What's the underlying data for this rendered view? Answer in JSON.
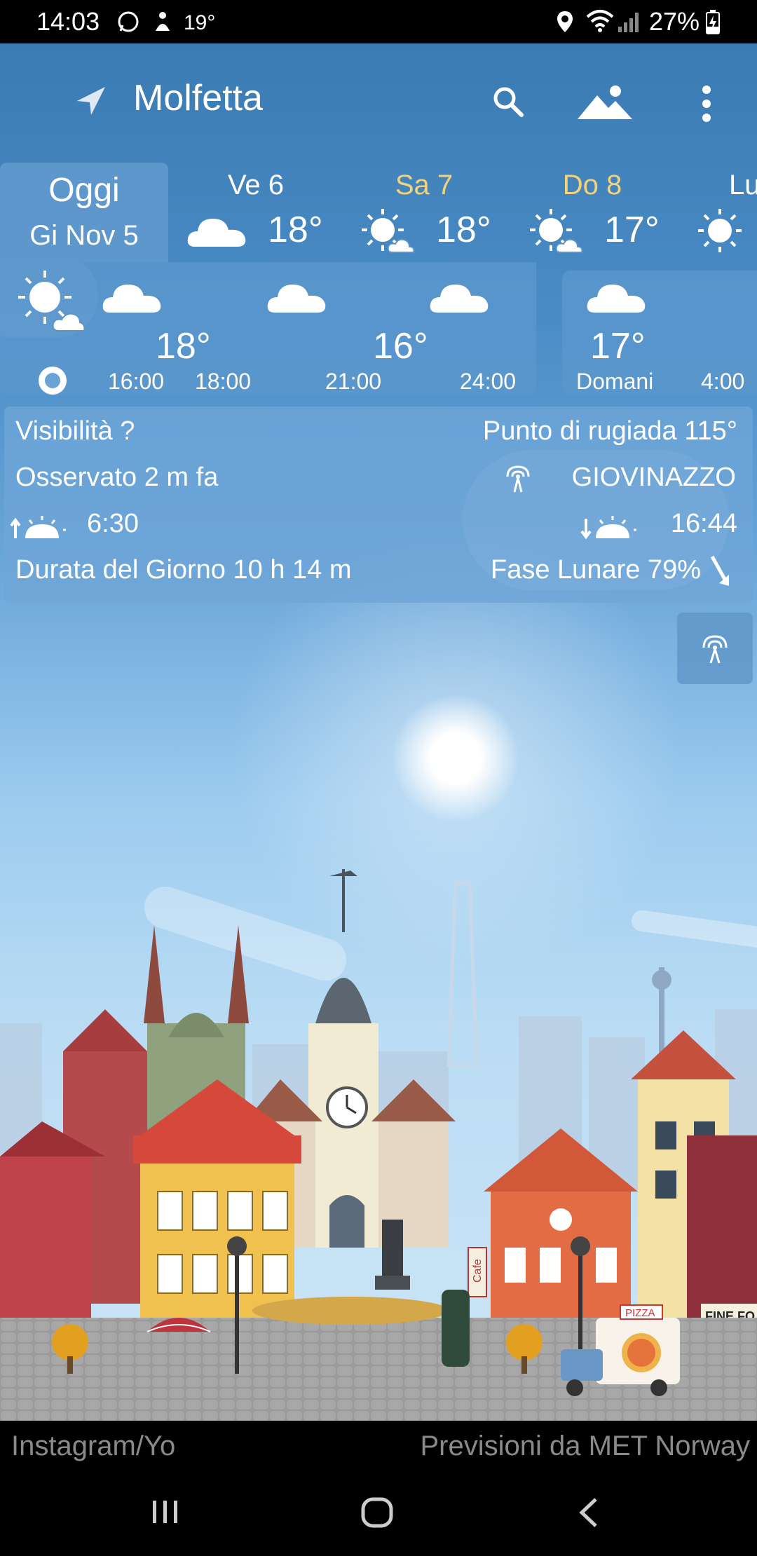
{
  "status_bar": {
    "time": "14:03",
    "notif_temp": "19°",
    "battery": "27%"
  },
  "header": {
    "city": "Molfetta"
  },
  "days": [
    {
      "name": "Oggi",
      "date": "Gi Nov 5"
    },
    {
      "name": "Ve 6",
      "temp": "18°",
      "icon": "cloud-icon"
    },
    {
      "name": "Sa 7",
      "temp": "18°",
      "icon": "sun-cloud-icon"
    },
    {
      "name": "Do 8",
      "temp": "17°",
      "icon": "sun-cloud-icon"
    },
    {
      "name": "Lu",
      "icon": "sun-icon"
    }
  ],
  "hourly": {
    "temps": [
      "18°",
      "16°",
      "17°"
    ],
    "times": [
      "16:00",
      "18:00",
      "21:00",
      "24:00",
      "Domani",
      "4:00"
    ]
  },
  "details": {
    "visibility": "Visibilità ?",
    "dew_point": "Punto di rugiada 115°",
    "observed": "Osservato 2 m fa",
    "station": "GIOVINAZZO",
    "sunrise": "6:30",
    "sunset": "16:44",
    "day_length": "Durata del Giorno 10 h 14 m",
    "moon_phase": "Fase Lunare 79%"
  },
  "town": {
    "pizza_sign": "PIZZA",
    "shop_sign": "FINE FO",
    "cafe_sign": "Cafe"
  },
  "credits": {
    "left": "Instagram/Yo",
    "right": "Previsioni da MET Norway"
  },
  "colors": {
    "weekend": "#f4d27a",
    "sky_top": "#3b7bb3",
    "panel": "#5d97cc"
  }
}
